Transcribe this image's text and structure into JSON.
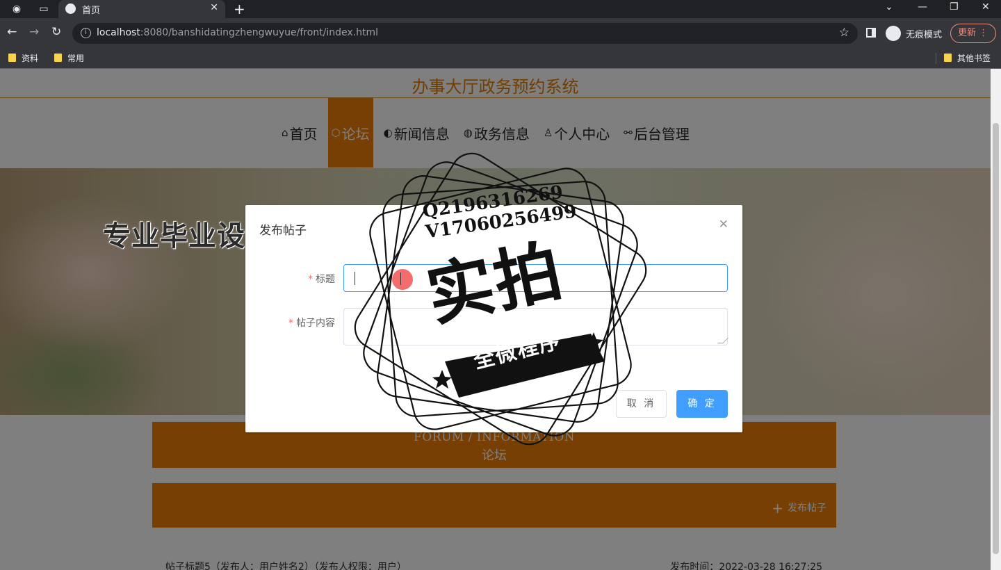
{
  "browser": {
    "tab_title": "首页",
    "url_host": "localhost",
    "url_rest": ":8080/banshidatingzhengwuyue/front/index.html",
    "incognito_label": "无痕模式",
    "update_label": "更新",
    "bookmarks": [
      "资料",
      "常用"
    ],
    "other_bookmarks": "其他书签"
  },
  "site": {
    "title": "办事大厅政务预约系统",
    "nav": [
      {
        "label": "首页",
        "icon": "home-icon",
        "glyph": "⌂",
        "active": false
      },
      {
        "label": "论坛",
        "icon": "cube-icon",
        "glyph": "⬡",
        "active": true
      },
      {
        "label": "新闻信息",
        "icon": "palette-icon",
        "glyph": "◐",
        "active": false
      },
      {
        "label": "政务信息",
        "icon": "globe-icon",
        "glyph": "◍",
        "active": false
      },
      {
        "label": "个人中心",
        "icon": "user-icon",
        "glyph": "♙",
        "active": false
      },
      {
        "label": "后台管理",
        "icon": "link-icon",
        "glyph": "⚯",
        "active": false
      }
    ]
  },
  "forum": {
    "heading_en": "FORUM / INFORMATION",
    "heading_zh": "论坛",
    "publish_label": "发布帖子",
    "post": {
      "text": "帖子标题5（发布人：用户姓名2）（发布人权限：用户）",
      "time": "发布时间：2022-03-28 16:27:25"
    }
  },
  "dialog": {
    "title": "发布帖子",
    "fields": [
      {
        "label": "标题",
        "required": true,
        "value": ""
      },
      {
        "label": "帖子内容",
        "required": true,
        "value": ""
      }
    ],
    "cancel_label": "取 消",
    "ok_label": "确 定"
  },
  "watermark": {
    "contact": [
      "Q2196316269",
      "V17060256499"
    ],
    "main": "实拍",
    "ribbon": "全微程序",
    "ad": "专业毕业设计代做"
  },
  "colors": {
    "brand_orange": "#f07f0a",
    "title_orange": "#e57c00",
    "primary_blue": "#409eff"
  }
}
